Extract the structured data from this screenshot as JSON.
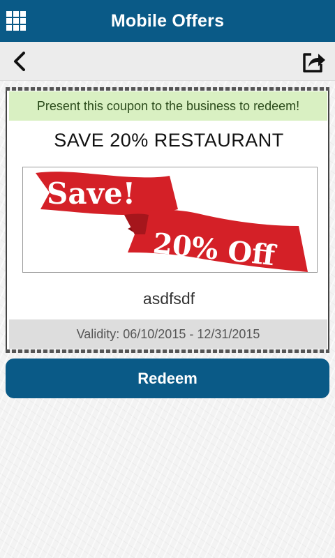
{
  "appbar": {
    "title": "Mobile Offers",
    "menu_icon": "grid-menu-icon"
  },
  "toolbar": {
    "back_icon": "chevron-left-icon",
    "share_icon": "share-icon"
  },
  "coupon": {
    "notice": "Present this coupon to the business to redeem!",
    "title": "SAVE 20% RESTAURANT",
    "image": {
      "text_primary": "Save!",
      "text_secondary": "20% Off",
      "ribbon_color": "#d42027"
    },
    "description": "asdfsdf",
    "validity": "Validity: 06/10/2015 - 12/31/2015"
  },
  "actions": {
    "redeem_label": "Redeem"
  },
  "colors": {
    "primary": "#0a5a87",
    "notice_bg": "#d9f0c2",
    "validity_bg": "#dddddd"
  }
}
